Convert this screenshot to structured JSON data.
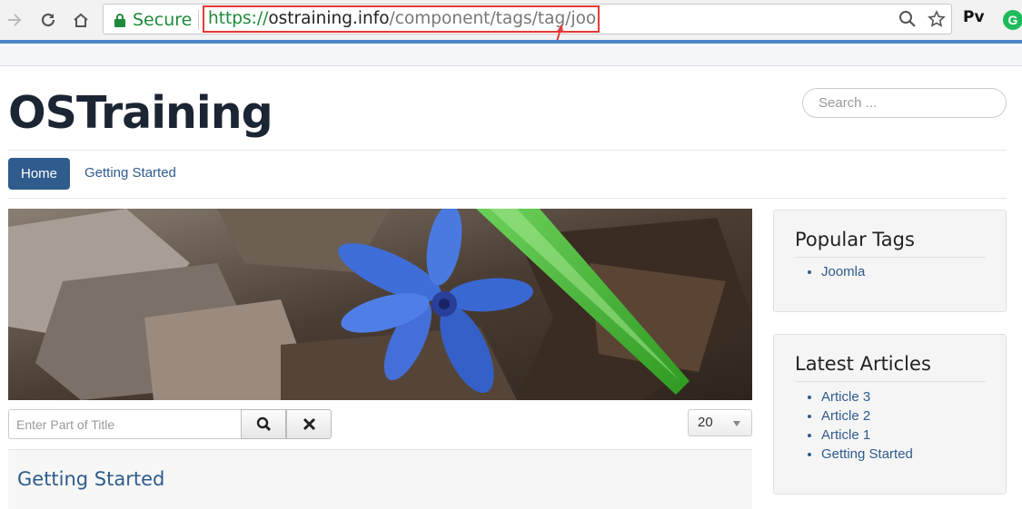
{
  "browser": {
    "secure_label": "Secure",
    "url_protocol": "https://",
    "url_host": "ostraining.info",
    "url_path": "/component/tags/tag/joomla",
    "extension_label": "Pv",
    "grammarly_letter": "G"
  },
  "site": {
    "title": "OSTraining",
    "search_placeholder": "Search ..."
  },
  "nav": {
    "items": [
      {
        "label": "Home"
      },
      {
        "label": "Getting Started"
      }
    ]
  },
  "tag_page": {
    "filter_placeholder": "Enter Part of Title",
    "limit_value": "20",
    "items": [
      {
        "title": "Getting Started"
      }
    ]
  },
  "sidebar": {
    "popular_tags": {
      "title": "Popular Tags",
      "items": [
        "Joomla"
      ]
    },
    "latest_articles": {
      "title": "Latest Articles",
      "items": [
        "Article 3",
        "Article 2",
        "Article 1",
        "Getting Started"
      ]
    }
  },
  "colors": {
    "link": "#2f5c8c",
    "nav_active": "#2f5c8c",
    "secure_green": "#1e8a3a",
    "highlight_red": "#e53935"
  }
}
